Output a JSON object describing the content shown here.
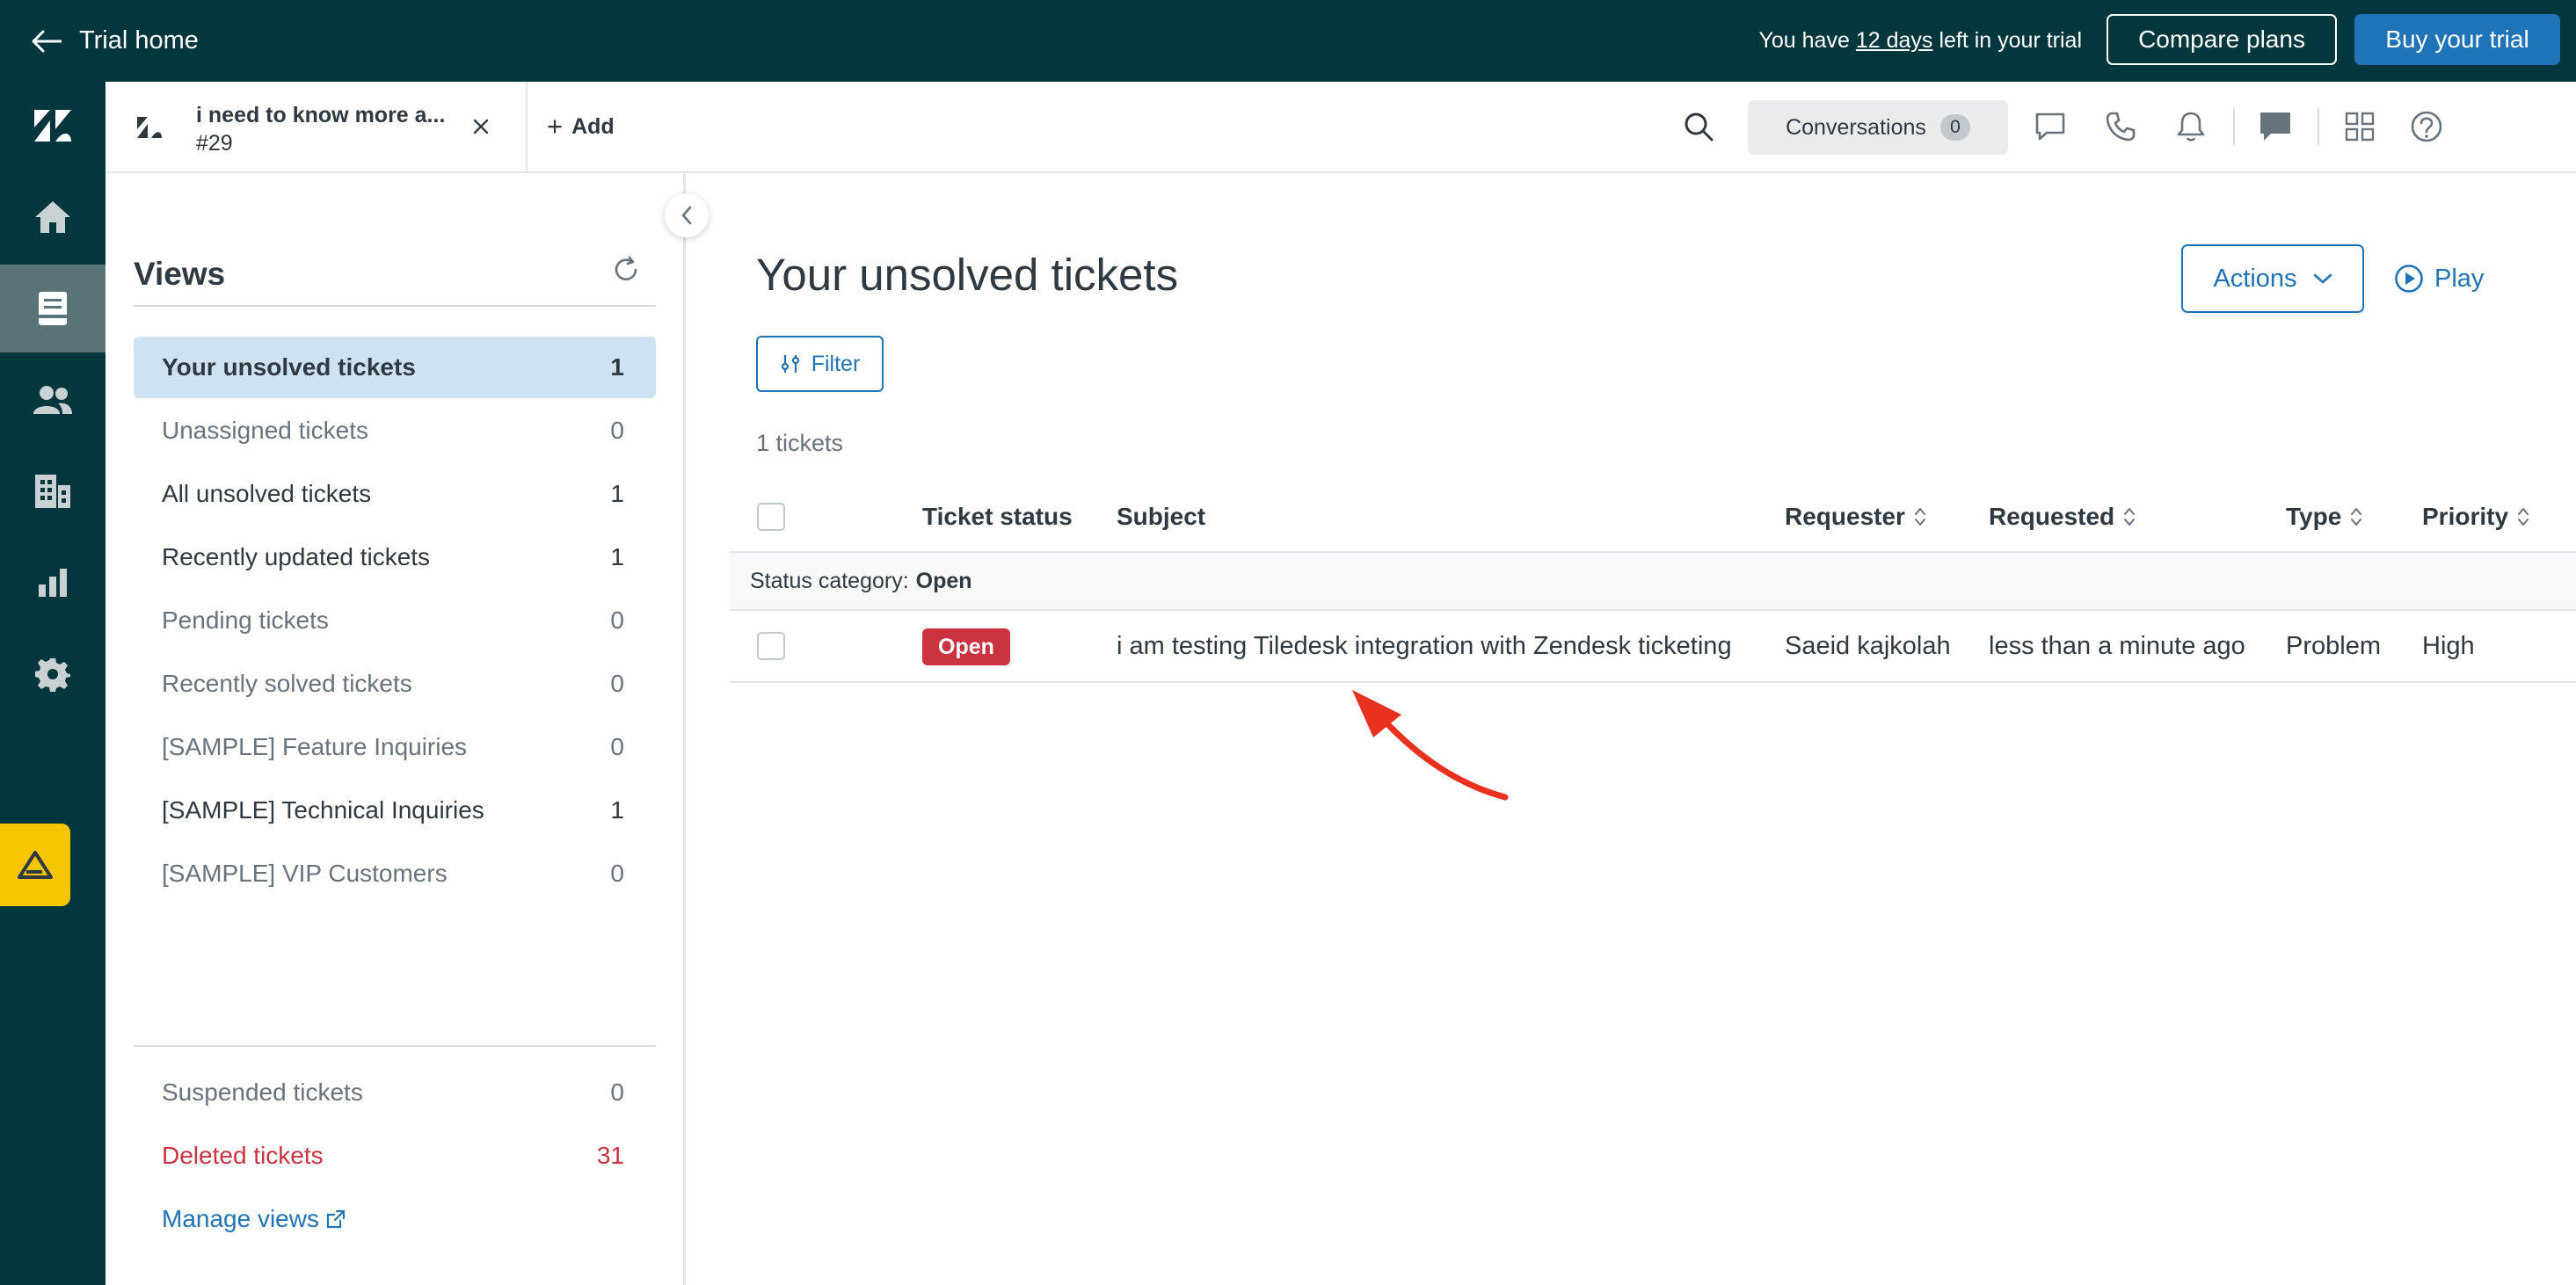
{
  "trial_bar": {
    "home_label": "Trial home",
    "msg_prefix": "You have",
    "msg_days": "12 days",
    "msg_suffix": "left in your trial",
    "compare_label": "Compare plans",
    "buy_label": "Buy your trial"
  },
  "colors": {
    "brand_dark": "#03363d",
    "accent_blue": "#1f73b7",
    "status_open": "#cc3340",
    "annotation": "#e8311f",
    "brand_yellow": "#f6c500"
  },
  "nav": [
    {
      "name": "home-icon",
      "active": false
    },
    {
      "name": "views-icon",
      "active": true
    },
    {
      "name": "customers-icon",
      "active": false
    },
    {
      "name": "organizations-icon",
      "active": false
    },
    {
      "name": "reporting-icon",
      "active": false
    },
    {
      "name": "admin-gear-icon",
      "active": false
    }
  ],
  "header": {
    "tab_title": "i need to know more a...",
    "tab_number": "#29",
    "add_label": "Add",
    "conversations_label": "Conversations",
    "conversations_count": "0"
  },
  "views": {
    "title": "Views",
    "items": [
      {
        "label": "Your unsolved tickets",
        "count": "1"
      },
      {
        "label": "Unassigned tickets",
        "count": "0"
      },
      {
        "label": "All unsolved tickets",
        "count": "1"
      },
      {
        "label": "Recently updated tickets",
        "count": "1"
      },
      {
        "label": "Pending tickets",
        "count": "0"
      },
      {
        "label": "Recently solved tickets",
        "count": "0"
      },
      {
        "label": "[SAMPLE] Feature Inquiries",
        "count": "0"
      },
      {
        "label": "[SAMPLE] Technical Inquiries",
        "count": "1"
      },
      {
        "label": "[SAMPLE] VIP Customers",
        "count": "0"
      }
    ],
    "suspended": {
      "label": "Suspended tickets",
      "count": "0"
    },
    "deleted": {
      "label": "Deleted tickets",
      "count": "31"
    },
    "manage_label": "Manage views"
  },
  "main": {
    "title": "Your unsolved tickets",
    "actions_label": "Actions",
    "play_label": "Play",
    "filter_label": "Filter",
    "tickets_count": "1 tickets",
    "columns": [
      "Ticket status",
      "Subject",
      "Requester",
      "Requested",
      "Type",
      "Priority"
    ],
    "group_label": "Status category:",
    "group_value": "Open",
    "rows": [
      {
        "status": "Open",
        "subject": "i am testing Tiledesk integration with Zendesk ticketing",
        "requester": "Saeid kajkolah",
        "requested": "less than a minute ago",
        "type": "Problem",
        "priority": "High"
      }
    ]
  }
}
